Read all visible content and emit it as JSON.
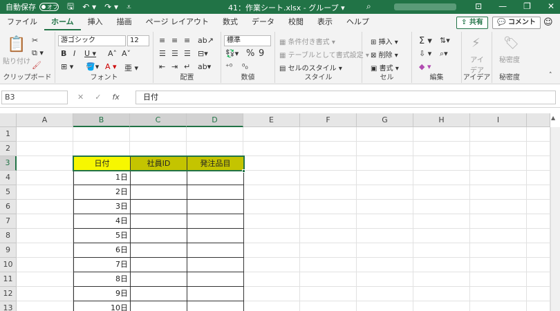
{
  "titlebar": {
    "autosave_label": "自動保存",
    "autosave_state": "オフ",
    "doc_title": "41：作業シート.xlsx - グループ ▾",
    "accent": "#217346"
  },
  "tabs": [
    "ファイル",
    "ホーム",
    "挿入",
    "描画",
    "ページ レイアウト",
    "数式",
    "データ",
    "校閲",
    "表示",
    "ヘルプ"
  ],
  "active_tab": "ホーム",
  "share_label": "共有",
  "comment_label": "コメント",
  "ribbon": {
    "clipboard": {
      "label": "クリップボード",
      "paste": "貼り付け"
    },
    "font": {
      "label": "フォント",
      "font_name": "游ゴシック",
      "font_size": "12"
    },
    "alignment": {
      "label": "配置"
    },
    "number": {
      "label": "数値",
      "format": "標準"
    },
    "style": {
      "label": "スタイル",
      "conditional": "条件付き書式",
      "table": "テーブルとして書式設定",
      "cell_style": "セルのスタイル"
    },
    "cells": {
      "label": "セル",
      "insert": "挿入",
      "delete": "削除",
      "format": "書式"
    },
    "editing": {
      "label": "編集"
    },
    "ideas": {
      "label": "アイデア",
      "btn": "アイデア"
    },
    "sensitivity": {
      "label": "秘密度",
      "btn": "秘密度"
    }
  },
  "formula_bar": {
    "name_box": "B3",
    "formula": "日付"
  },
  "columns": [
    "A",
    "B",
    "C",
    "D",
    "E",
    "F",
    "G",
    "H",
    "I"
  ],
  "rows": [
    "1",
    "2",
    "3",
    "4",
    "5",
    "6",
    "7",
    "8",
    "9",
    "10",
    "11",
    "12",
    "13"
  ],
  "table": {
    "headers": [
      "日付",
      "社員ID",
      "発注品目"
    ],
    "dates": [
      "1日",
      "2日",
      "3日",
      "4日",
      "5日",
      "6日",
      "7日",
      "8日",
      "9日",
      "10日"
    ]
  },
  "colors": {
    "header_yellow": "#f7f700",
    "header_olive": "#c4c400",
    "selection": "#217346"
  }
}
